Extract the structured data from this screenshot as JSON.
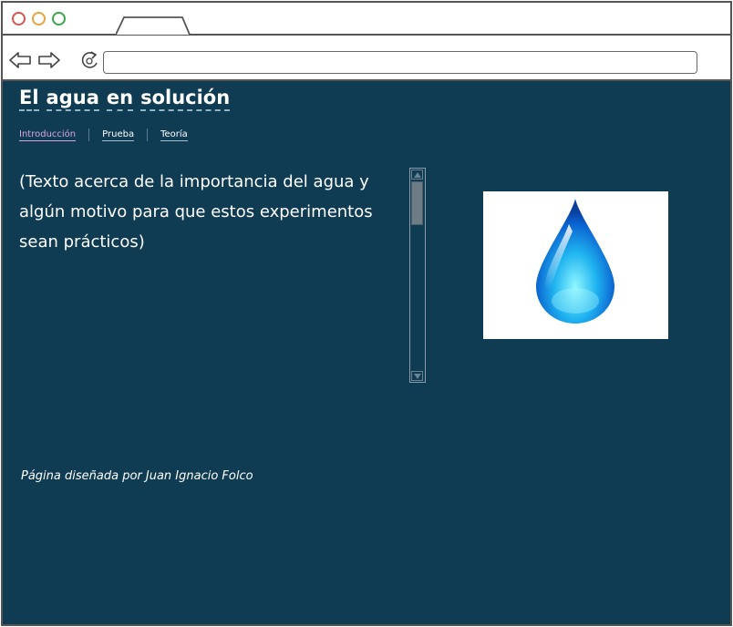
{
  "page": {
    "title": "El agua en solución",
    "title_words": [
      "El",
      "agua",
      "en",
      "solución"
    ],
    "nav": [
      {
        "label": "Introducción",
        "active": true
      },
      {
        "label": "Prueba",
        "active": false
      },
      {
        "label": "Teoría",
        "active": false
      }
    ],
    "intro_text": "(Texto acerca de la importancia del agua y algún motivo para que estos experimentos sean prácticos)",
    "footer": "Página diseñada por Juan Ignacio Folco"
  },
  "browser": {
    "url": "",
    "icons": [
      "back-arrow-icon",
      "forward-arrow-icon",
      "reload-icon"
    ]
  },
  "colors": {
    "background": "#103c53",
    "text": "#ffffff",
    "active_tab": "#d7a4e6",
    "drop_blue": "#1a8fe0"
  }
}
